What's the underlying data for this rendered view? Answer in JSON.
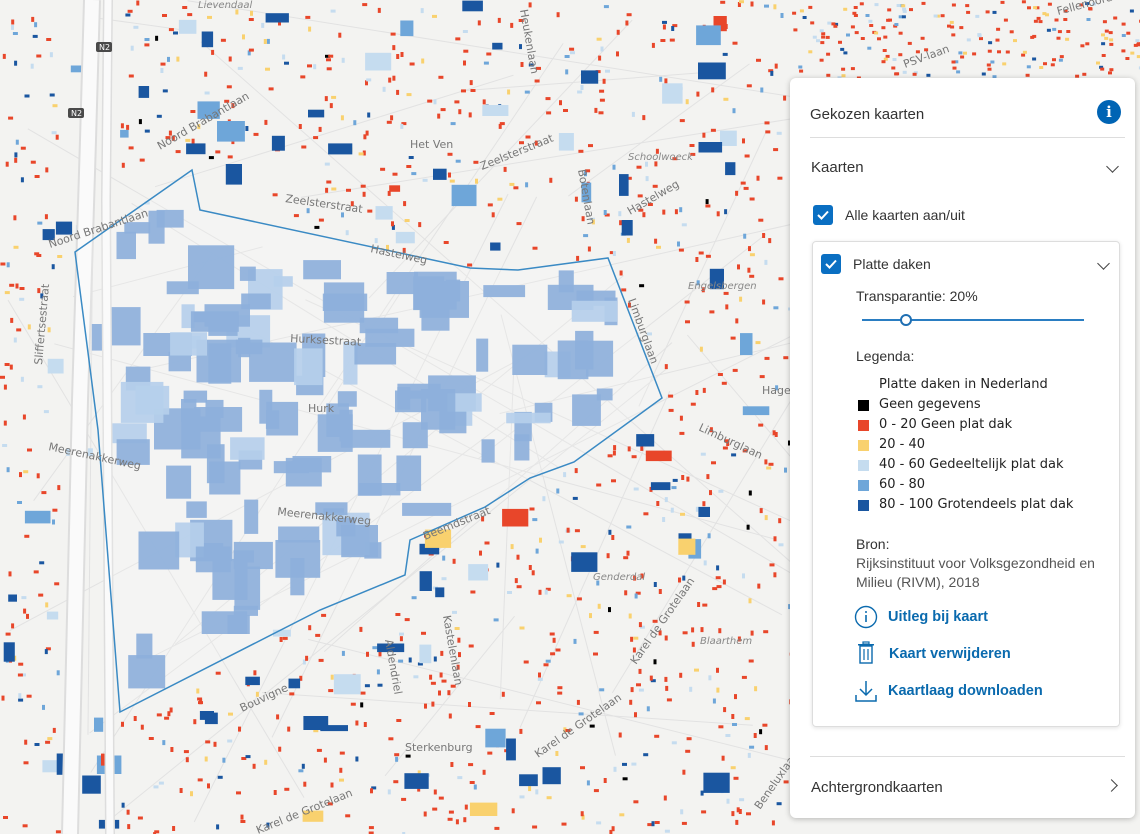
{
  "map": {
    "streets": [
      "Noord Brabantlaan",
      "Noord Brabantlaan",
      "Zeelsterstraat",
      "Zeelsterstraat",
      "Hastelweg",
      "Hastelweg",
      "Het Ven",
      "Botenlaan",
      "Heukenlaan",
      "Hurksestraat",
      "Hurk",
      "Meerenakkerweg",
      "Meerenakkerweg",
      "Beemdstraat",
      "Limburglaan",
      "Limburglaan",
      "Engelsbergen",
      "Schoolwoeck",
      "Genderdal",
      "Karel de Grotelaan",
      "Karel de Grotelaan",
      "Karel de Grotelaan",
      "Blaarthem",
      "Sterkenburg",
      "Bouvigne",
      "Aldendriel",
      "Kastelenlaan",
      "Sliffertsestraat",
      "Lievendaal",
      "PSV-laan",
      "Fellenoord",
      "Hage",
      "N2",
      "N2",
      "Beneluxlaan"
    ]
  },
  "panel": {
    "title": "Gekozen kaarten",
    "info_icon": "info-icon",
    "maps_section": "Kaarten",
    "all_toggle_label": "Alle kaarten aan/uit",
    "layer": {
      "name": "Platte daken",
      "transparency_label": "Transparantie:",
      "transparency_value": "20%",
      "transparency_percent": 20,
      "legend_title": "Legenda:",
      "legend_heading": "Platte daken in Nederland",
      "legend": [
        {
          "label": "Geen gegevens",
          "color": "#000000"
        },
        {
          "label": "0 - 20 Geen plat dak",
          "color": "#e8462a"
        },
        {
          "label": "20 - 40",
          "color": "#f9d16e"
        },
        {
          "label": "40 - 60 Gedeeltelijk plat dak",
          "color": "#c5dcef"
        },
        {
          "label": "60 - 80",
          "color": "#6ea6d9"
        },
        {
          "label": "80 - 100 Grotendeels plat dak",
          "color": "#1a56a0"
        }
      ],
      "source_title": "Bron:",
      "source_text_1": "Rijksinstituut voor Volksgezondheid en",
      "source_text_2": "Milieu (RIVM), 2018",
      "actions": {
        "explain": "Uitleg bij kaart",
        "remove": "Kaart verwijderen",
        "download": "Kaartlaag downloaden"
      }
    },
    "background_section": "Achtergrondkaarten"
  }
}
